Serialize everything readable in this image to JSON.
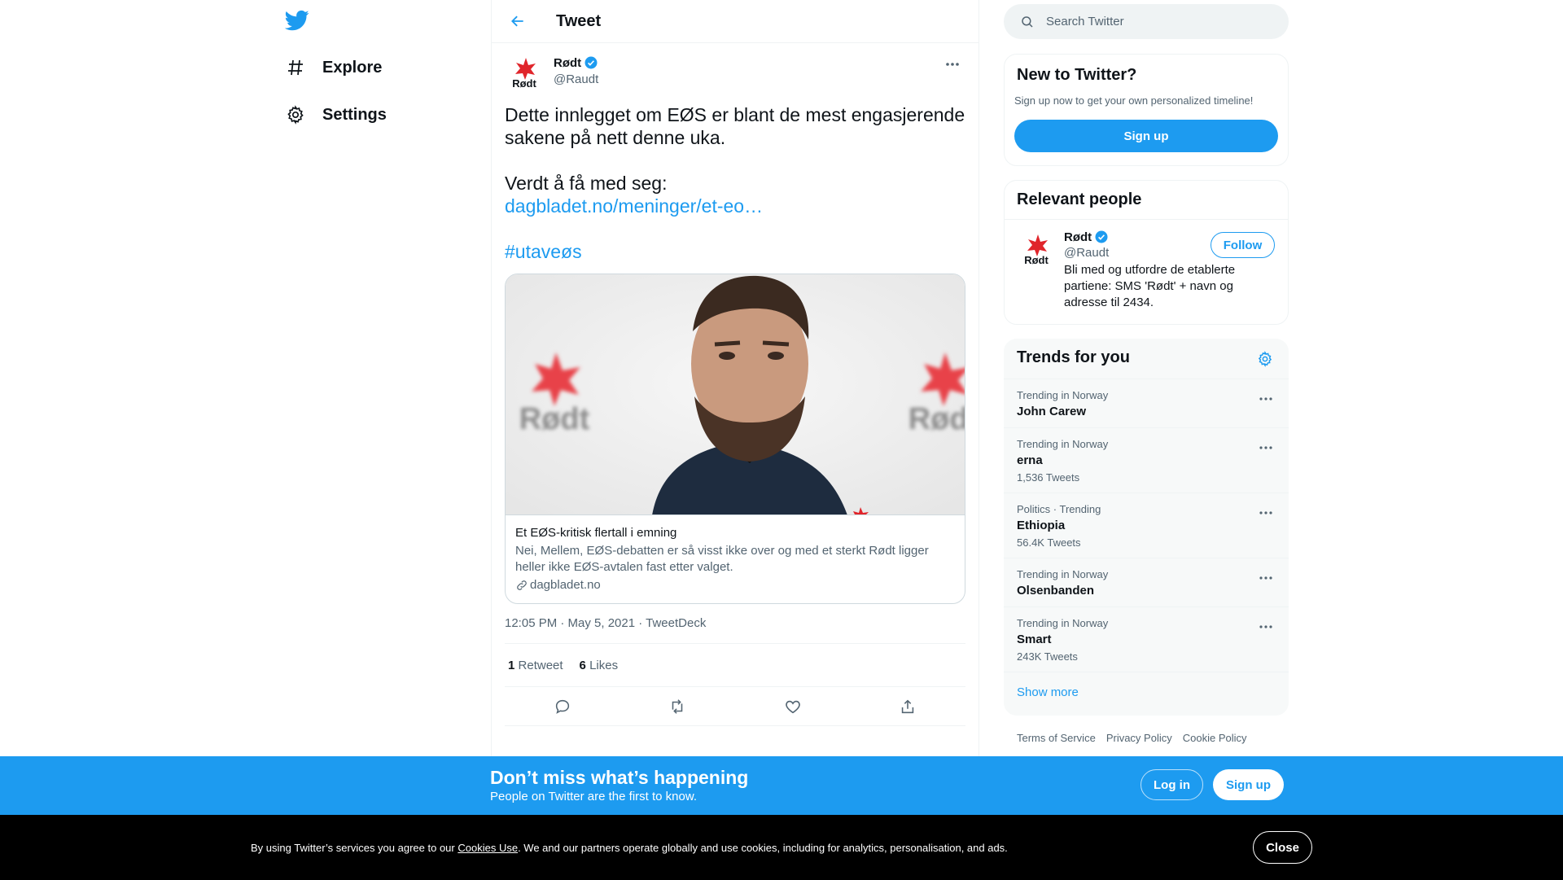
{
  "nav": {
    "items": [
      {
        "label": "Explore",
        "icon": "hashtag-icon"
      },
      {
        "label": "Settings",
        "icon": "gear-icon"
      }
    ]
  },
  "header": {
    "title": "Tweet"
  },
  "tweet": {
    "author_name": "Rødt",
    "author_handle": "@Raudt",
    "avatar_text": "Rødt",
    "text_line1": "Dette innlegget om EØS er blant de mest engasjerende sakene på nett denne uka.",
    "text_line2": "Verdt å få med seg:",
    "link": "dagbladet.no/meninger/et-eo…",
    "hashtag": "#utaveøs",
    "card": {
      "image_logo_text": "Rødt",
      "title": "Et EØS-kritisk flertall i emning",
      "description": "Nei, Mellem, EØS-debatten er så visst ikke over og med et sterkt Rødt ligger heller ikke EØS-avtalen fast etter valget.",
      "domain": "dagbladet.no"
    },
    "timestamp": "12:05 PM · May 5, 2021 · TweetDeck",
    "retweets": {
      "count": "1",
      "label": "Retweet"
    },
    "likes": {
      "count": "6",
      "label": "Likes"
    }
  },
  "search": {
    "placeholder": "Search Twitter"
  },
  "new_to_twitter": {
    "title": "New to Twitter?",
    "subtitle": "Sign up now to get your own personalized timeline!",
    "button": "Sign up"
  },
  "relevant_people": {
    "title": "Relevant people",
    "person": {
      "name": "Rødt",
      "handle": "@Raudt",
      "bio": "Bli med og utfordre de etablerte partiene: SMS 'Rødt' + navn og adresse til 2434.",
      "follow_label": "Follow"
    }
  },
  "trends": {
    "title": "Trends for you",
    "items": [
      {
        "context": "Trending in Norway",
        "name": "John Carew",
        "count": ""
      },
      {
        "context": "Trending in Norway",
        "name": "erna",
        "count": "1,536 Tweets"
      },
      {
        "context": "Politics · Trending",
        "name": "Ethiopia",
        "count": "56.4K Tweets"
      },
      {
        "context": "Trending in Norway",
        "name": "Olsenbanden",
        "count": ""
      },
      {
        "context": "Trending in Norway",
        "name": "Smart",
        "count": "243K Tweets"
      }
    ],
    "show_more": "Show more"
  },
  "footer": {
    "links": [
      "Terms of Service",
      "Privacy Policy",
      "Cookie Policy"
    ]
  },
  "promo": {
    "title": "Don’t miss what’s happening",
    "subtitle": "People on Twitter are the first to know.",
    "login": "Log in",
    "signup": "Sign up"
  },
  "cookie": {
    "text_before": "By using Twitter’s services you agree to our ",
    "link": "Cookies Use",
    "text_after": ". We and our partners operate globally and use cookies, including for analytics, personalisation, and ads.",
    "close": "Close"
  },
  "colors": {
    "accent": "#1d9bf0",
    "text": "#0f1419",
    "secondary": "#536471",
    "party_red": "#e0252b"
  }
}
